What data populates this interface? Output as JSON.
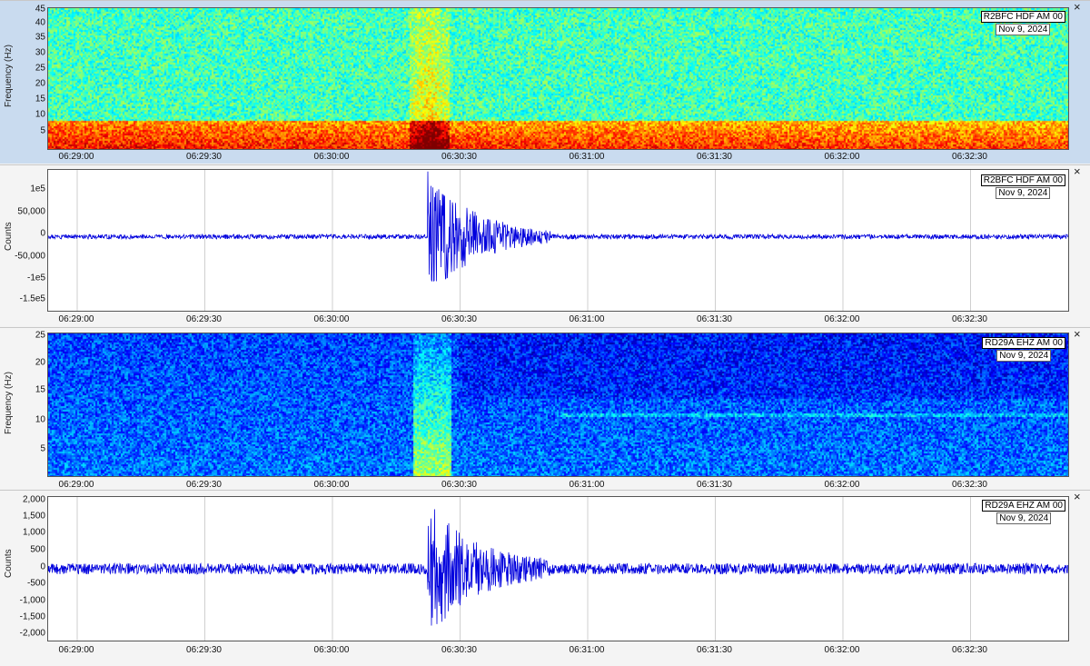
{
  "window": {
    "close_icon": "×"
  },
  "x_axis": {
    "ticks": [
      "06:29:00",
      "06:29:30",
      "06:30:00",
      "06:30:30",
      "06:31:00",
      "06:31:30",
      "06:32:00",
      "06:32:30"
    ]
  },
  "panels": [
    {
      "kind": "spectrogram",
      "station": "R2BFC HDF AM 00",
      "date": "Nov 9, 2024",
      "ylabel": "Frequency (Hz)",
      "yticks": [
        "45",
        "40",
        "35",
        "30",
        "25",
        "20",
        "15",
        "10",
        "5"
      ],
      "ymax": 45
    },
    {
      "kind": "waveform",
      "station": "R2BFC HDF AM 00",
      "date": "Nov 9, 2024",
      "ylabel": "Counts",
      "yticks": [
        "1e5",
        "50,000",
        "0",
        "-50,000",
        "-1e5",
        "-1.5e5"
      ],
      "color": "#0000dd"
    },
    {
      "kind": "spectrogram",
      "station": "RD29A EHZ AM 00",
      "date": "Nov 9, 2024",
      "ylabel": "Frequency (Hz)",
      "yticks": [
        "25",
        "20",
        "15",
        "10",
        "5"
      ],
      "ymax": 25
    },
    {
      "kind": "waveform",
      "station": "RD29A EHZ AM 00",
      "date": "Nov 9, 2024",
      "ylabel": "Counts",
      "yticks": [
        "2,000",
        "1,500",
        "1,000",
        "500",
        "0",
        "-500",
        "-1,000",
        "-1,500",
        "-2,000"
      ],
      "color": "#0000dd"
    }
  ]
}
